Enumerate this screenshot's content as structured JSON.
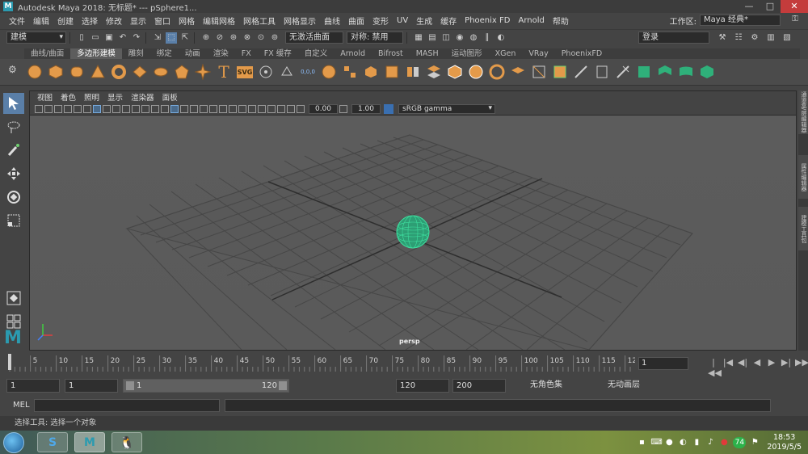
{
  "window": {
    "app_icon": "M",
    "title": "Autodesk Maya 2018: 无标题*   ---   pSphere1...",
    "controls": [
      "—",
      "□",
      "✕"
    ]
  },
  "menu": {
    "items": [
      "文件",
      "编辑",
      "创建",
      "选择",
      "修改",
      "显示",
      "窗口",
      "网格",
      "编辑网格",
      "网格工具",
      "网格显示",
      "曲线",
      "曲面",
      "变形",
      "UV",
      "生成",
      "缓存",
      "Phoenix FD",
      "Arnold",
      "帮助"
    ],
    "workspace_label": "工作区:",
    "workspace_value": "Maya 经典*"
  },
  "status_line": {
    "mode": "建模",
    "live_surface": "无激活曲面",
    "symmetry": "对称: 禁用",
    "login": "登录"
  },
  "shelf": {
    "tabs": [
      "曲线/曲面",
      "多边形建模",
      "雕刻",
      "绑定",
      "动画",
      "渲染",
      "FX",
      "FX 缓存",
      "自定义",
      "Arnold",
      "Bifrost",
      "MASH",
      "运动图形",
      "XGen",
      "VRay",
      "PhoenixFD"
    ],
    "active_tab": 1,
    "text_icon_T": "T",
    "svg_label": "SVG",
    "coord_label": "0,0,0"
  },
  "panel": {
    "menus": [
      "视图",
      "着色",
      "照明",
      "显示",
      "渲染器",
      "面板"
    ],
    "exposure": "0.00",
    "gamma": "1.00",
    "color_space": "sRGB gamma",
    "camera": "persp"
  },
  "right_tabs": [
    "通道盒/层编辑器",
    "属性编辑器",
    "建模工具包"
  ],
  "timeline": {
    "ticks": [
      "5",
      "10",
      "15",
      "20",
      "25",
      "30",
      "35",
      "40",
      "45",
      "50",
      "55",
      "60",
      "65",
      "70",
      "75",
      "80",
      "85",
      "90",
      "95",
      "100",
      "105",
      "110",
      "115",
      "12"
    ],
    "current_frame": "1",
    "playback_icons": [
      "|◀◀",
      "|◀",
      "◀|",
      "◀",
      "▶",
      "▶|",
      "▶▶|",
      "↻"
    ]
  },
  "range": {
    "start": "1",
    "current": "1",
    "range_start": "1",
    "range_end": "120",
    "anim_end": "120",
    "max_end": "200",
    "char_set": "无角色集",
    "anim_layer": "无动画层"
  },
  "command": {
    "label": "MEL"
  },
  "help": "选择工具: 选择一个对象",
  "taskbar": {
    "apps": [
      "S",
      "M",
      "🐧"
    ],
    "tray_badge": "74",
    "time": "18:53",
    "date": "2019/5/5"
  },
  "colors": {
    "accent_blue": "#5a7fa8",
    "maya_teal": "#2b9bb0",
    "shelf_orange": "#e39a4a",
    "selection_green": "#3fe0a0"
  }
}
